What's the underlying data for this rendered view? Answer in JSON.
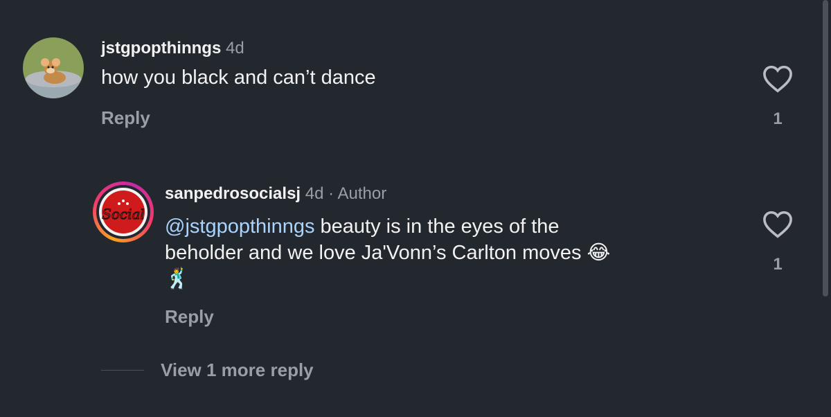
{
  "comments": [
    {
      "username": "jstgpopthinngs",
      "time": "4d",
      "text": "how you black and can’t dance",
      "reply_label": "Reply",
      "likes": "1"
    },
    {
      "username": "sanpedrosocialsj",
      "time": "4d",
      "separator": "·",
      "badge": "Author",
      "mention": "@jstgpopthinngs",
      "text_line1": "beauty is in the eyes of the",
      "text_line2": "beholder and we love Ja'Vonn’s Carlton moves",
      "emoji1": "😂",
      "emoji2": "🕺",
      "reply_label": "Reply",
      "likes": "1"
    }
  ],
  "more_replies_label": "View 1 more reply",
  "colors": {
    "background": "#23272e",
    "mention": "#a9d4ff",
    "muted": "#9a9ea5"
  }
}
